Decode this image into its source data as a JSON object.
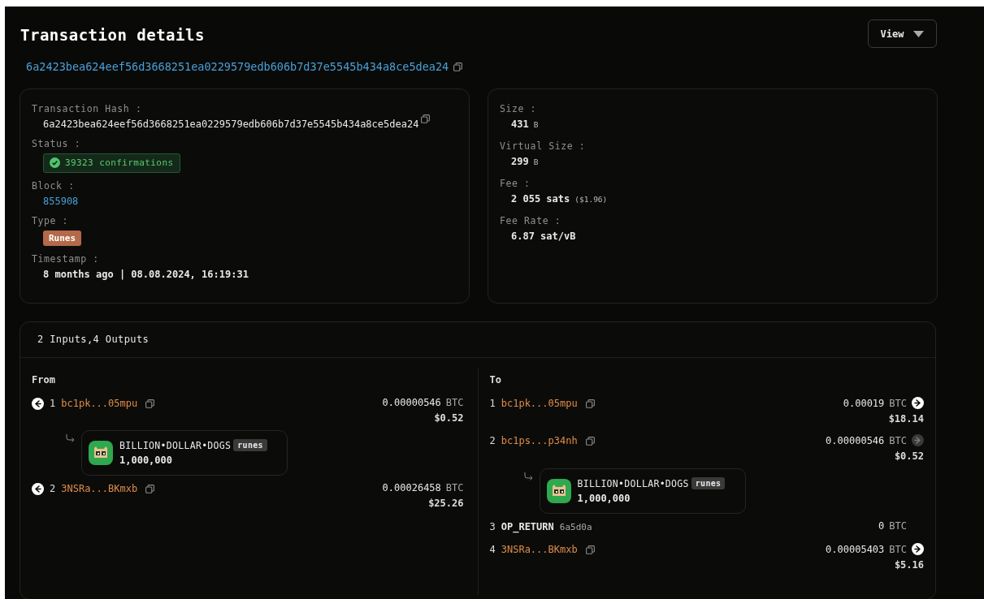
{
  "header": {
    "title": "Transaction details",
    "view_button": "View",
    "txid": "6a2423bea624eef56d3668251ea0229579edb606b7d37e5545b434a8ce5dea24"
  },
  "details": [
    {
      "label": "Transaction Hash :",
      "kind": "hash",
      "value": "6a2423bea624eef56d3668251ea0229579edb606b7d37e5545b434a8ce5dea24"
    },
    {
      "label": "Status :",
      "kind": "status",
      "value": "39323 confirmations"
    },
    {
      "label": "Block :",
      "kind": "link",
      "value": "855908"
    },
    {
      "label": "Type :",
      "kind": "tag",
      "value": "Runes"
    },
    {
      "label": "Timestamp :",
      "kind": "text",
      "value": "8 months ago | 08.08.2024, 16:19:31"
    }
  ],
  "sizes": [
    {
      "label": "Size :",
      "value": "431",
      "unit": "B"
    },
    {
      "label": "Virtual Size :",
      "value": "299",
      "unit": "B"
    },
    {
      "label": "Fee :",
      "value": "2 055 sats",
      "unit": "($1.96)"
    },
    {
      "label": "Fee Rate :",
      "value": "6.87 sat/vB"
    }
  ],
  "io": {
    "summary": "2 Inputs,4 Outputs",
    "from_label": "From",
    "to_label": "To",
    "inputs": [
      {
        "index": "1",
        "address": "bc1pk...05mpu",
        "amount": "0.00000546",
        "unit": "BTC",
        "usd": "$0.52",
        "rune": {
          "name": "BILLION•DOLLAR•DOGS",
          "tag": "runes",
          "amount": "1,000,000"
        }
      },
      {
        "index": "2",
        "address": "3NSRa...BKmxb",
        "amount": "0.00026458",
        "unit": "BTC",
        "usd": "$25.26"
      }
    ],
    "outputs": [
      {
        "kind": "address",
        "index": "1",
        "address": "bc1pk...05mpu",
        "amount": "0.00019",
        "unit": "BTC",
        "usd": "$18.14",
        "spent": true
      },
      {
        "kind": "address",
        "index": "2",
        "address": "bc1ps...p34nh",
        "amount": "0.00000546",
        "unit": "BTC",
        "usd": "$0.52",
        "spent": false,
        "rune": {
          "name": "BILLION•DOLLAR•DOGS",
          "tag": "runes",
          "amount": "1,000,000"
        }
      },
      {
        "kind": "op_return",
        "index": "3",
        "address": "OP_RETURN",
        "data": "6a5d0a",
        "amount": "0",
        "unit": "BTC"
      },
      {
        "kind": "address",
        "index": "4",
        "address": "3NSRa...BKmxb",
        "amount": "0.00005403",
        "unit": "BTC",
        "usd": "$5.16",
        "spent": true
      }
    ]
  }
}
